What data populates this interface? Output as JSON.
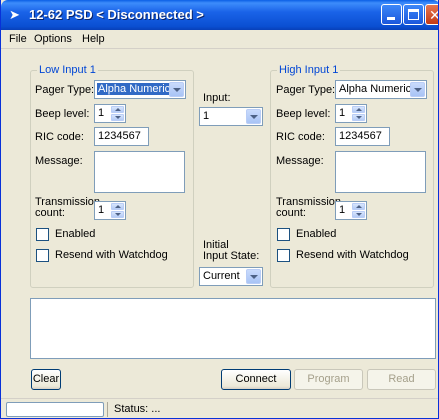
{
  "window": {
    "title": "12-62 PSD < Disconnected >"
  },
  "menu": [
    "File",
    "Options",
    "Help"
  ],
  "low_input": {
    "group_label": "Low Input 1",
    "pager_type_label": "Pager Type:",
    "pager_type_value": "Alpha Numeric",
    "beep_level_label": "Beep level:",
    "beep_level_value": "1",
    "ric_code_label": "RIC code:",
    "ric_code_value": "1234567",
    "message_label": "Message:",
    "message_value": "",
    "transmission_count_label_1": "Transmission",
    "transmission_count_label_2": "count:",
    "transmission_count_value": "1",
    "enabled_label": "Enabled",
    "enabled_checked": false,
    "resend_label": "Resend with Watchdog",
    "resend_checked": false
  },
  "middle": {
    "input_label": "Input:",
    "input_value": "1",
    "initial_state_label_1": "Initial",
    "initial_state_label_2": "Input State:",
    "initial_state_value": "Current"
  },
  "high_input": {
    "group_label": "High Input 1",
    "pager_type_label": "Pager Type:",
    "pager_type_value": "Alpha Numeric",
    "beep_level_label": "Beep level:",
    "beep_level_value": "1",
    "ric_code_label": "RIC code:",
    "ric_code_value": "1234567",
    "message_label": "Message:",
    "message_value": "",
    "transmission_count_label_1": "Transmission",
    "transmission_count_label_2": "count:",
    "transmission_count_value": "1",
    "enabled_label": "Enabled",
    "enabled_checked": false,
    "resend_label": "Resend with Watchdog",
    "resend_checked": false
  },
  "log_text": "",
  "buttons": {
    "clear": "Clear",
    "connect": "Connect",
    "program": "Program",
    "read": "Read"
  },
  "status": {
    "text": "Status: ...",
    "progress": 0
  },
  "icons": {
    "app": "pager-icon",
    "minimize": "minimize-icon",
    "maximize": "maximize-icon",
    "close": "close-icon"
  },
  "colors": {
    "title_bar": "#0a5fe6",
    "group_label": "#0046d5",
    "selection": "#316ac5",
    "window_bg": "#ece9d8"
  }
}
